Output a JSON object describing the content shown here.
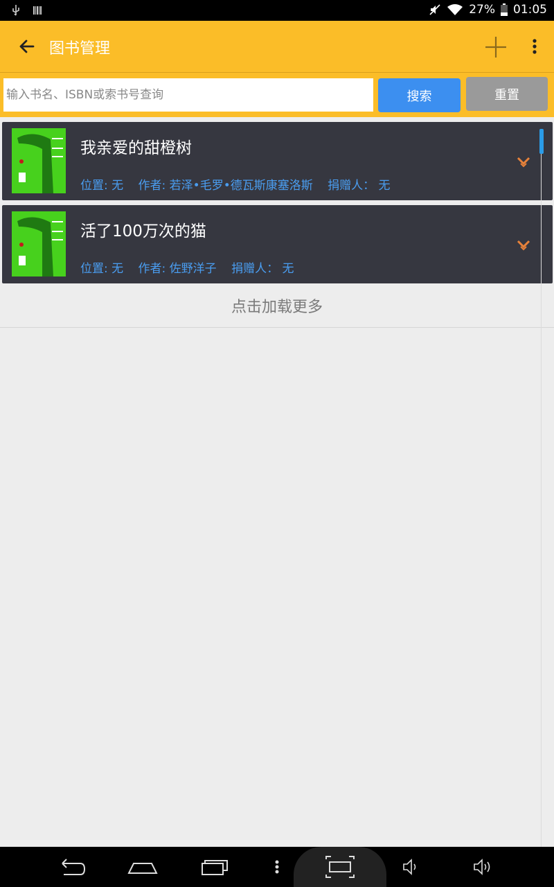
{
  "status_bar": {
    "battery": "27%",
    "time": "01:05"
  },
  "app_bar": {
    "title": "图书管理",
    "icons": [
      "back-arrow-icon",
      "plus-icon",
      "more-vert-icon"
    ]
  },
  "search": {
    "placeholder": "输入书名、ISBN或索书号查询",
    "value": "",
    "search_label": "搜索",
    "reset_label": "重置"
  },
  "books": [
    {
      "title": "我亲爱的甜橙树",
      "location": "位置: 无",
      "author": "作者: 若泽•毛罗•德瓦斯康塞洛斯",
      "donor": "捐赠人： 无"
    },
    {
      "title": "活了100万次的猫",
      "location": "位置: 无",
      "author": "作者: 佐野洋子",
      "donor": "捐赠人： 无"
    }
  ],
  "load_more": "点击加载更多",
  "colors": {
    "appbar": "#fbbd28",
    "card": "#363740",
    "meta_text": "#4a9df0",
    "search_button": "#3c8ff0",
    "reset_button": "#9a9a9a",
    "expand_chevron": "#e8823a"
  }
}
